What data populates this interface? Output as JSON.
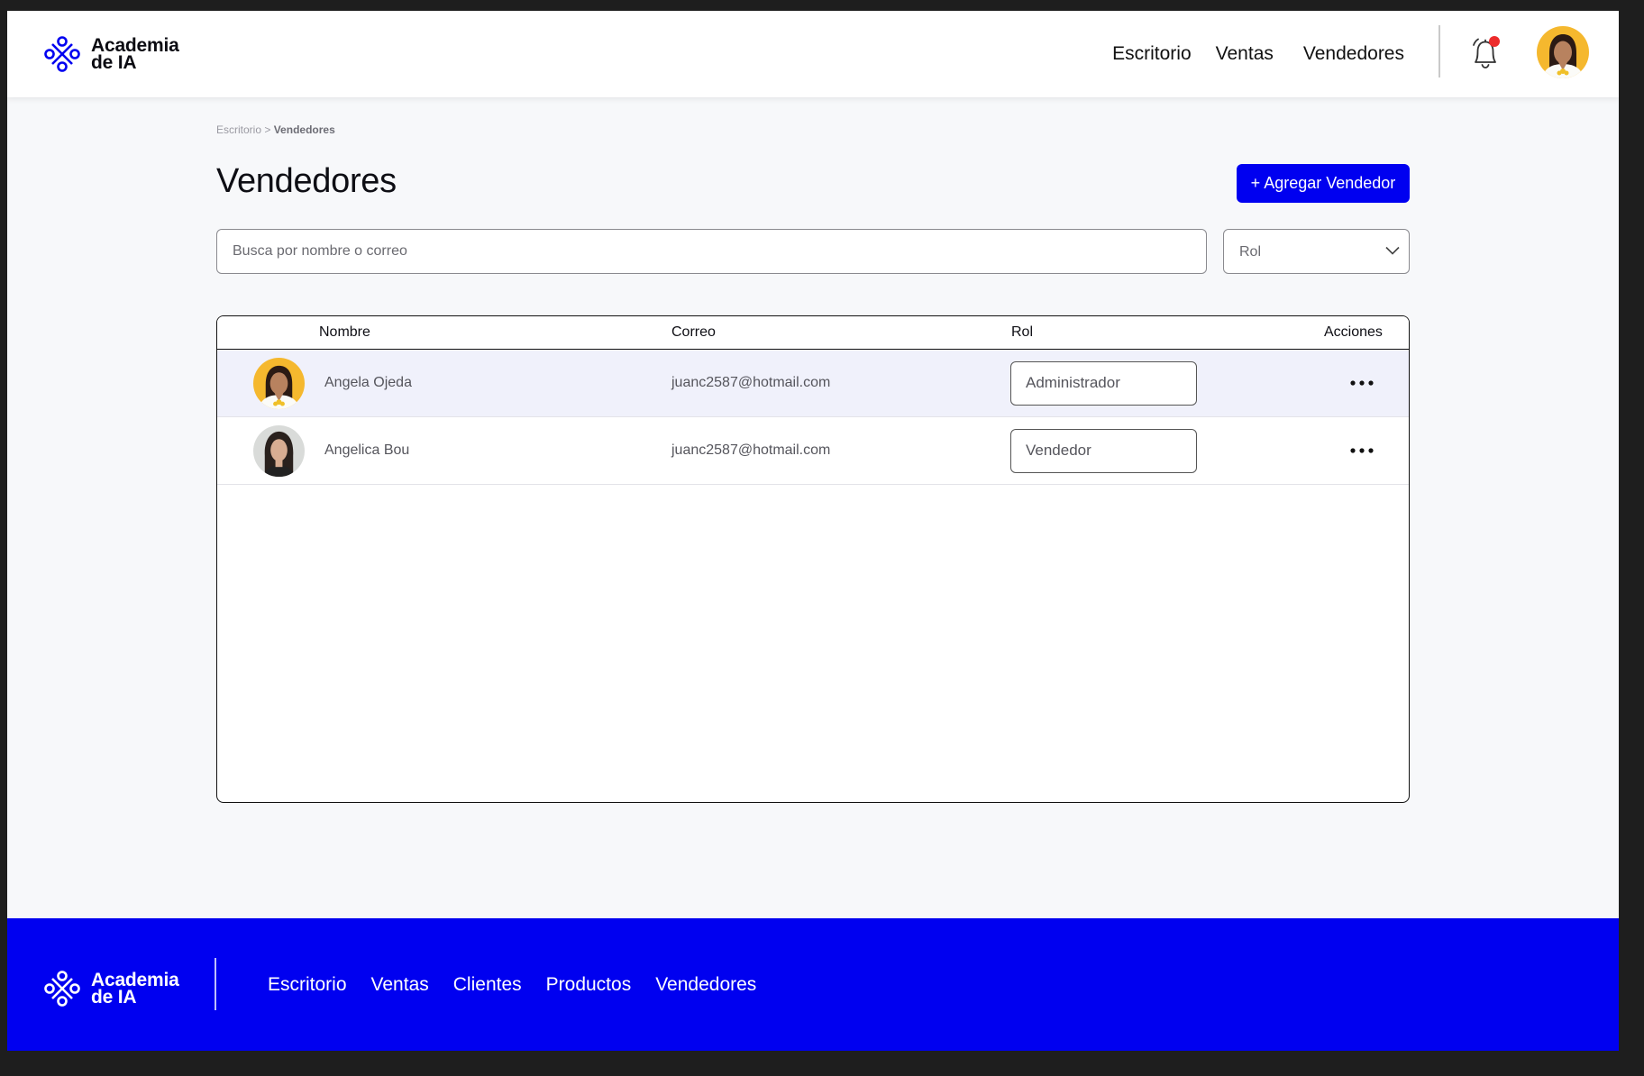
{
  "brand": {
    "line1": "Academia",
    "line2": "de IA"
  },
  "topnav": {
    "items": [
      "Escritorio",
      "Ventas",
      "Vendedores"
    ]
  },
  "breadcrumb": {
    "parent": "Escritorio",
    "separator": ">",
    "current": "Vendedores"
  },
  "page": {
    "title": "Vendedores",
    "add_button": "+ Agregar Vendedor"
  },
  "search": {
    "placeholder": "Busca por nombre o correo"
  },
  "role_filter": {
    "label": "Rol"
  },
  "table": {
    "headers": {
      "name": "Nombre",
      "email": "Correo",
      "role": "Rol",
      "actions": "Acciones"
    },
    "rows": [
      {
        "name": "Angela Ojeda",
        "email": "juanc2587@hotmail.com",
        "role": "Administrador"
      },
      {
        "name": "Angelica Bou",
        "email": "juanc2587@hotmail.com",
        "role": "Vendedor"
      }
    ]
  },
  "footer": {
    "nav": [
      "Escritorio",
      "Ventas",
      "Clientes",
      "Productos",
      "Vendedores"
    ]
  },
  "colors": {
    "brand_blue": "#0000f0",
    "notification_dot": "#ec2b2b",
    "avatar_yellow": "#f5b82e"
  },
  "icons": [
    "logo-icon",
    "bell-icon",
    "chevron-down-icon",
    "more-dots-icon"
  ]
}
